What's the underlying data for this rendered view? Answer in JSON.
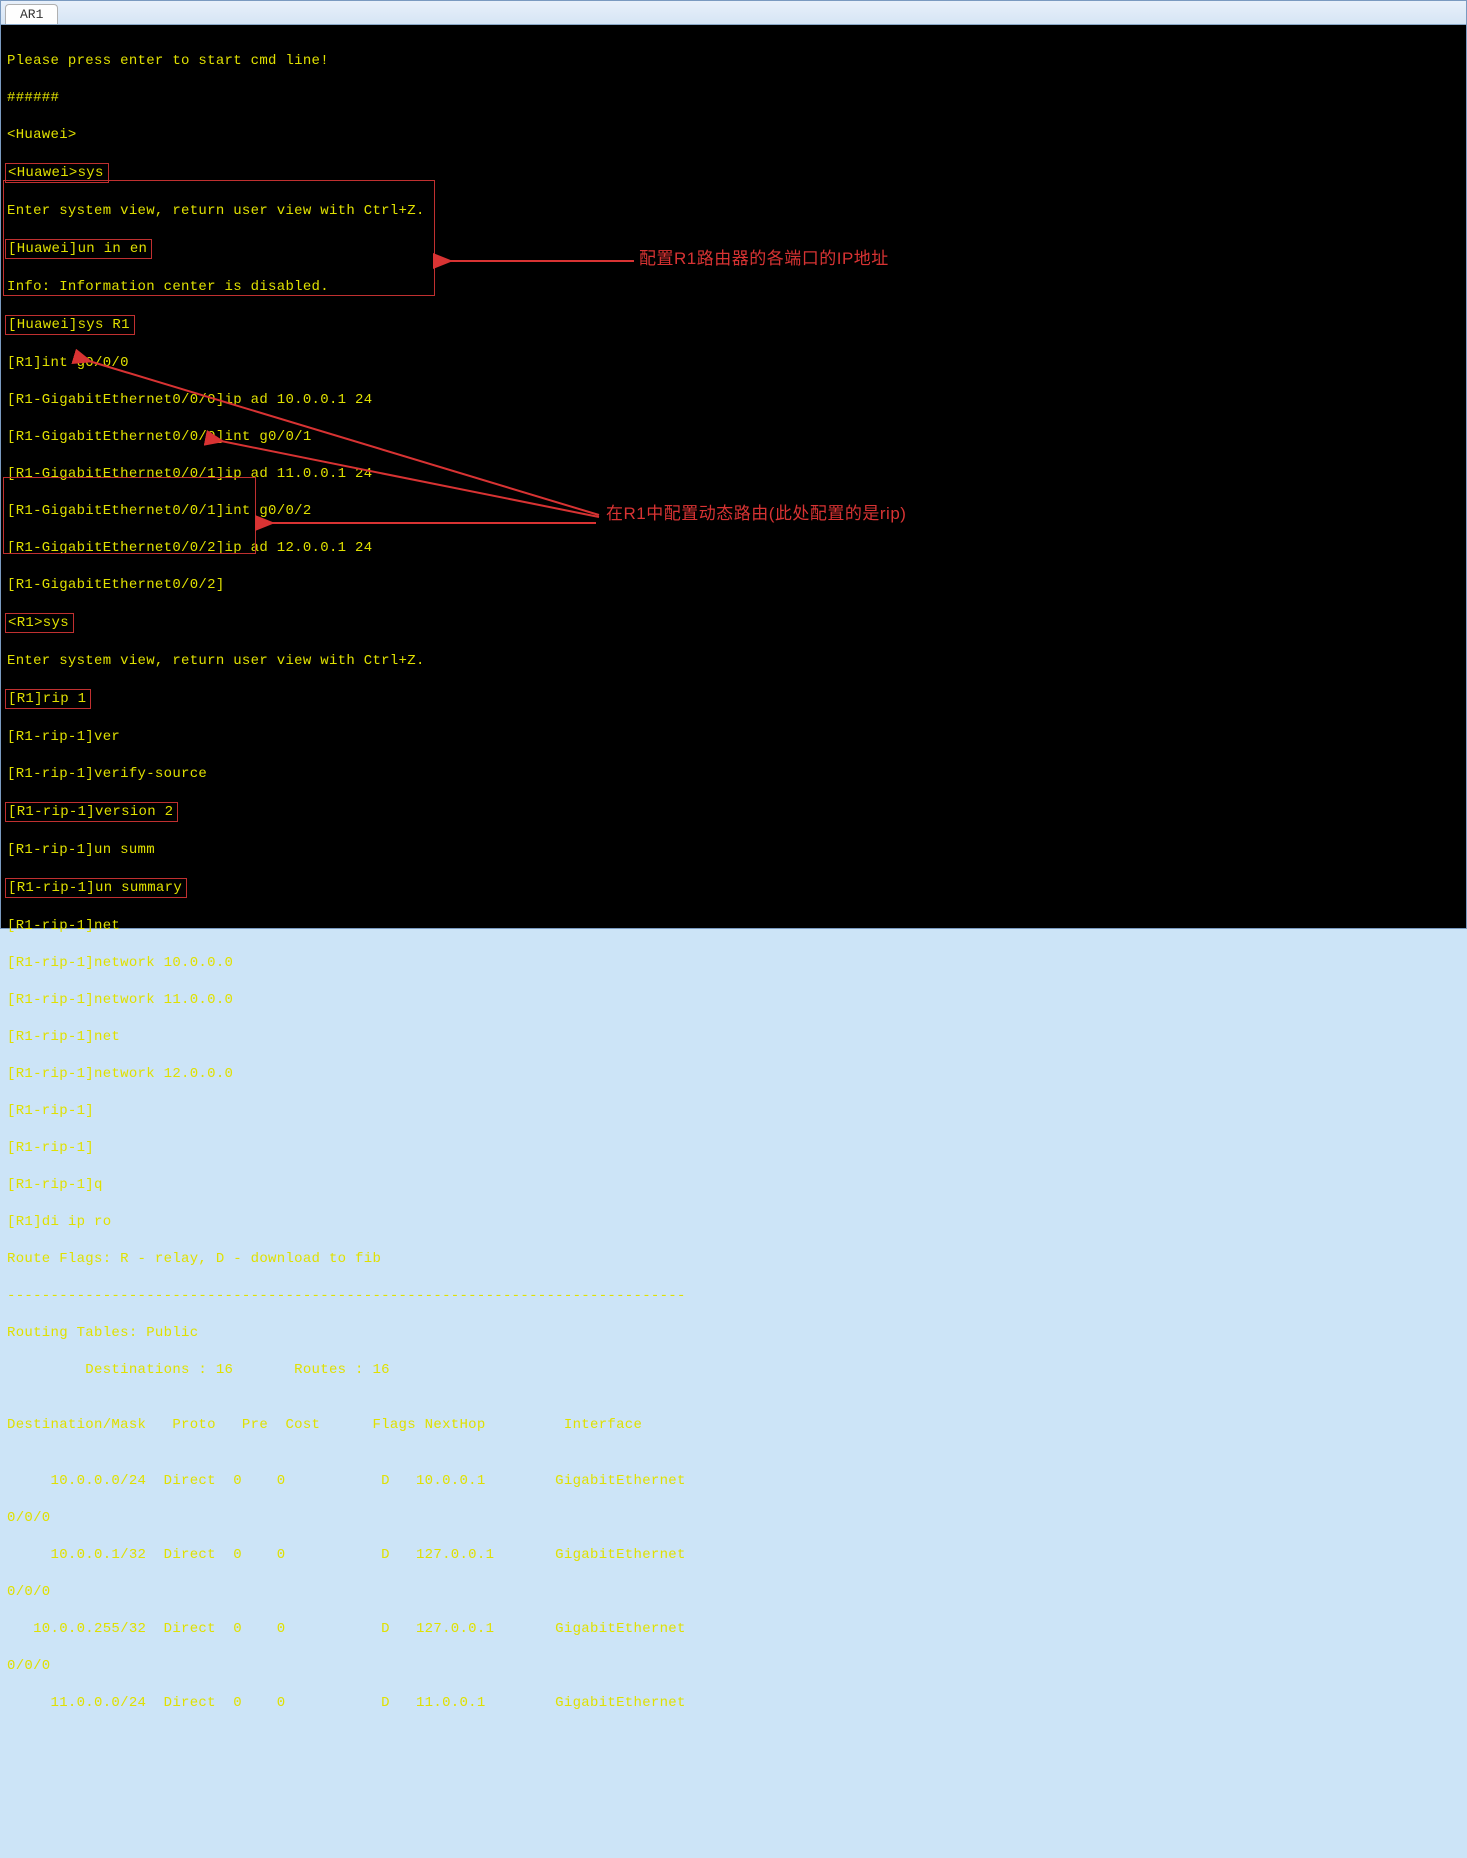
{
  "tab": {
    "label": "AR1"
  },
  "annotations": {
    "a1": "配置R1路由器的各端口的IP地址",
    "a2": "在R1中配置动态路由(此处配置的是rip)"
  },
  "lines": {
    "l1": "Please press enter to start cmd line!",
    "l2": "######",
    "l3": "<Huawei>",
    "l4": "<Huawei>sys",
    "l5": "Enter system view, return user view with Ctrl+Z.",
    "l6": "[Huawei]un in en",
    "l7": "Info: Information center is disabled.",
    "l8": "[Huawei]sys R1",
    "l9": "[R1]int g0/0/0",
    "l10": "[R1-GigabitEthernet0/0/0]ip ad 10.0.0.1 24",
    "l11": "[R1-GigabitEthernet0/0/0]int g0/0/1",
    "l12": "[R1-GigabitEthernet0/0/1]ip ad 11.0.0.1 24",
    "l13": "[R1-GigabitEthernet0/0/1]int g0/0/2",
    "l14": "[R1-GigabitEthernet0/0/2]ip ad 12.0.0.1 24",
    "l15": "[R1-GigabitEthernet0/0/2]",
    "l16": "<R1>sys",
    "l17": "Enter system view, return user view with Ctrl+Z.",
    "l18": "[R1]rip 1",
    "l19": "[R1-rip-1]ver",
    "l20": "[R1-rip-1]verify-source",
    "l21": "[R1-rip-1]version 2",
    "l22": "[R1-rip-1]un summ",
    "l23": "[R1-rip-1]un summary",
    "l24": "[R1-rip-1]net",
    "l25": "[R1-rip-1]network 10.0.0.0",
    "l26": "[R1-rip-1]network 11.0.0.0",
    "l27": "[R1-rip-1]net",
    "l28": "[R1-rip-1]network 12.0.0.0",
    "l29": "[R1-rip-1]",
    "l30": "[R1-rip-1]",
    "l31": "[R1-rip-1]q",
    "l32": "[R1]di ip ro",
    "l33": "Route Flags: R - relay, D - download to fib",
    "l34": "------------------------------------------------------------------------------",
    "l35": "Routing Tables: Public",
    "l36": "         Destinations : 16       Routes : 16",
    "l37": "",
    "l38": "Destination/Mask   Proto   Pre  Cost      Flags NextHop         Interface",
    "l39": "",
    "r1a": "     10.0.0.0/24  Direct  0    0           D   10.0.0.1        GigabitEthernet",
    "r1b": "0/0/0",
    "r2a": "     10.0.0.1/32  Direct  0    0           D   127.0.0.1       GigabitEthernet",
    "r2b": "0/0/0",
    "r3a": "   10.0.0.255/32  Direct  0    0           D   127.0.0.1       GigabitEthernet",
    "r3b": "0/0/0",
    "r4a": "     11.0.0.0/24  Direct  0    0           D   11.0.0.1        GigabitEthernet"
  }
}
